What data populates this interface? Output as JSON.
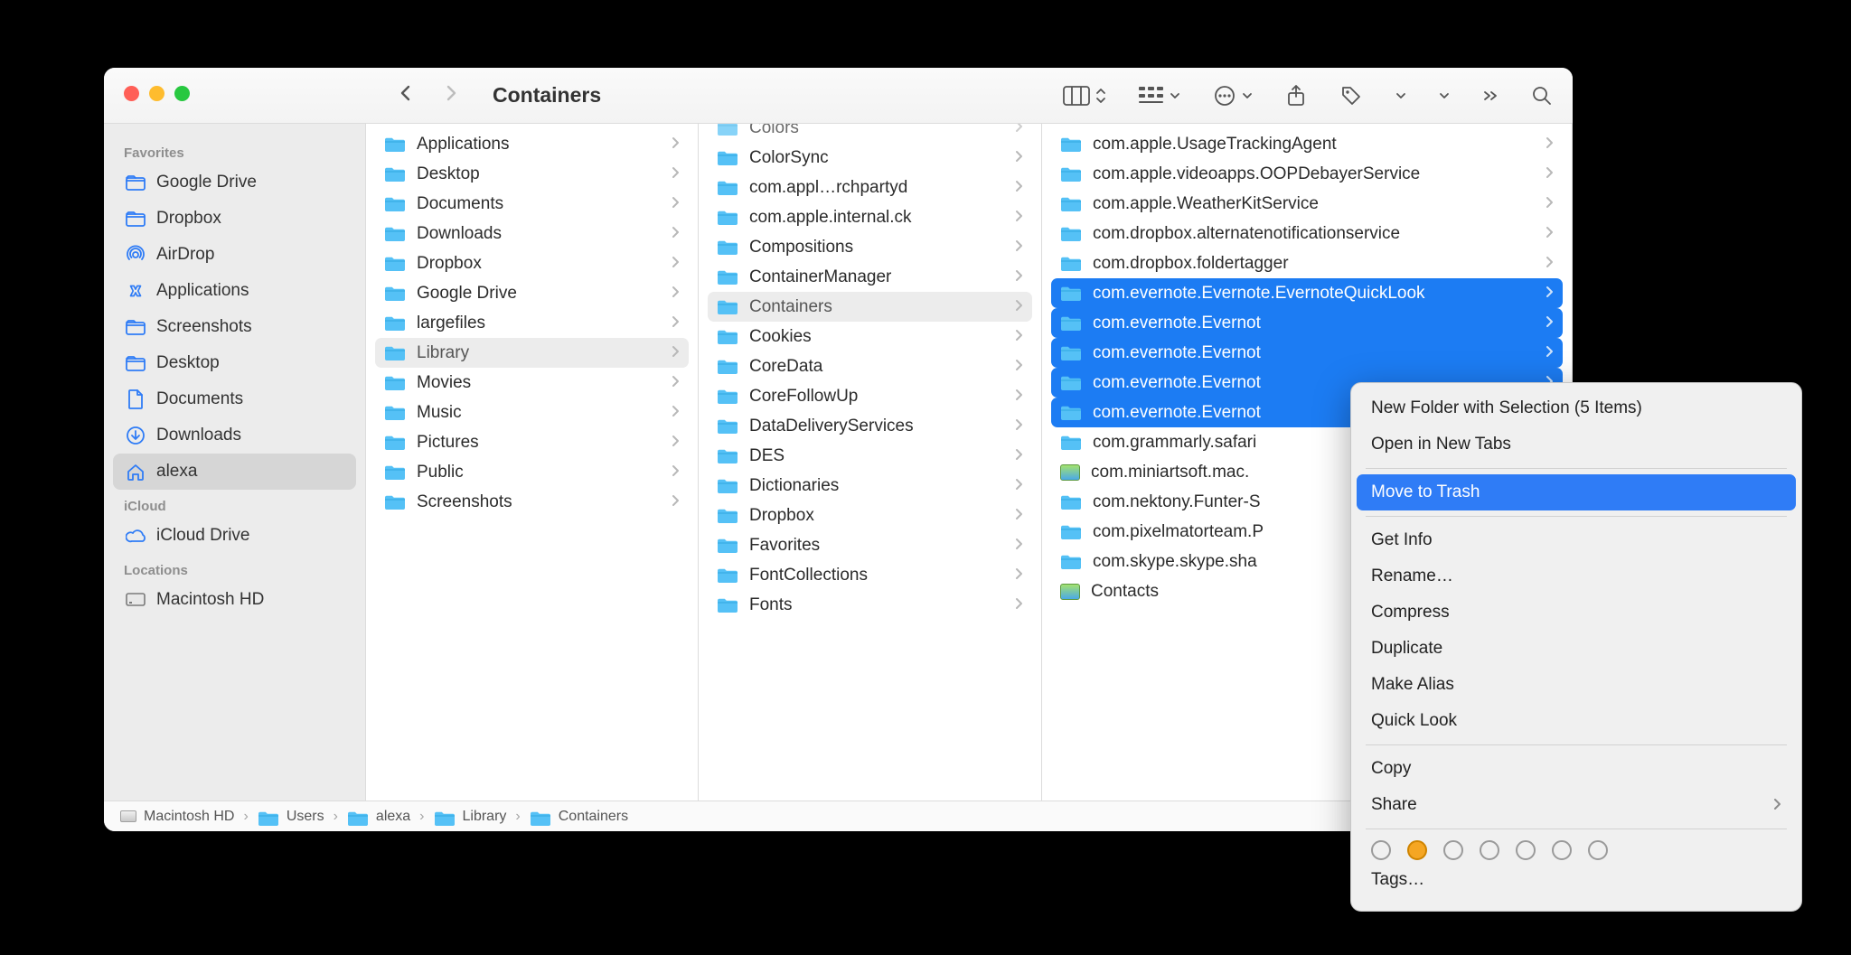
{
  "window": {
    "title": "Containers"
  },
  "sidebar": {
    "sections": [
      {
        "title": "Favorites",
        "items": [
          {
            "icon": "folder",
            "label": "Google Drive",
            "sel": false
          },
          {
            "icon": "folder",
            "label": "Dropbox",
            "sel": false
          },
          {
            "icon": "airdrop",
            "label": "AirDrop",
            "sel": false
          },
          {
            "icon": "app",
            "label": "Applications",
            "sel": false
          },
          {
            "icon": "folder",
            "label": "Screenshots",
            "sel": false
          },
          {
            "icon": "folder",
            "label": "Desktop",
            "sel": false
          },
          {
            "icon": "doc",
            "label": "Documents",
            "sel": false
          },
          {
            "icon": "down",
            "label": "Downloads",
            "sel": false
          },
          {
            "icon": "home",
            "label": "alexa",
            "sel": true
          }
        ]
      },
      {
        "title": "iCloud",
        "items": [
          {
            "icon": "cloud",
            "label": "iCloud Drive",
            "sel": false
          }
        ]
      },
      {
        "title": "Locations",
        "items": [
          {
            "icon": "disk",
            "label": "Macintosh HD",
            "sel": false
          }
        ]
      }
    ]
  },
  "columns": {
    "c1": [
      {
        "label": "Applications",
        "chev": true
      },
      {
        "label": "Desktop",
        "chev": true
      },
      {
        "label": "Documents",
        "chev": true
      },
      {
        "label": "Downloads",
        "chev": true
      },
      {
        "label": "Dropbox",
        "chev": true
      },
      {
        "label": "Google Drive",
        "chev": true
      },
      {
        "label": "largefiles",
        "chev": true
      },
      {
        "label": "Library",
        "chev": true,
        "sel": true
      },
      {
        "label": "Movies",
        "chev": true
      },
      {
        "label": "Music",
        "chev": true
      },
      {
        "label": "Pictures",
        "chev": true
      },
      {
        "label": "Public",
        "chev": true
      },
      {
        "label": "Screenshots",
        "chev": true
      }
    ],
    "c2_top": {
      "label": "Colors",
      "chev": true
    },
    "c2": [
      {
        "label": "ColorSync",
        "chev": true
      },
      {
        "label": "com.appl…rchpartyd",
        "chev": true
      },
      {
        "label": "com.apple.internal.ck",
        "chev": true
      },
      {
        "label": "Compositions",
        "chev": true
      },
      {
        "label": "ContainerManager",
        "chev": true
      },
      {
        "label": "Containers",
        "chev": true,
        "sel": true
      },
      {
        "label": "Cookies",
        "chev": true
      },
      {
        "label": "CoreData",
        "chev": true
      },
      {
        "label": "CoreFollowUp",
        "chev": true
      },
      {
        "label": "DataDeliveryServices",
        "chev": true
      },
      {
        "label": "DES",
        "chev": true
      },
      {
        "label": "Dictionaries",
        "chev": true
      },
      {
        "label": "Dropbox",
        "chev": true
      },
      {
        "label": "Favorites",
        "chev": true
      },
      {
        "label": "FontCollections",
        "chev": true
      },
      {
        "label": "Fonts",
        "chev": true
      }
    ],
    "c3": [
      {
        "label": "com.apple.UsageTrackingAgent",
        "chev": true
      },
      {
        "label": "com.apple.videoapps.OOPDebayerService",
        "chev": true
      },
      {
        "label": "com.apple.WeatherKitService",
        "chev": true
      },
      {
        "label": "com.dropbox.alternatenotificationservice",
        "chev": true
      },
      {
        "label": "com.dropbox.foldertagger",
        "chev": true
      },
      {
        "label": "com.evernote.Evernote.EvernoteQuickLook",
        "chev": true,
        "sel": true
      },
      {
        "label": "com.evernote.Evernot",
        "chev": true,
        "sel": true,
        "clip": true
      },
      {
        "label": "com.evernote.Evernot",
        "chev": true,
        "sel": true,
        "clip": true
      },
      {
        "label": "com.evernote.Evernot",
        "chev": true,
        "sel": true,
        "clip": true
      },
      {
        "label": "com.evernote.Evernot",
        "chev": true,
        "sel": true,
        "clip": true
      },
      {
        "label": "com.grammarly.safari",
        "chev": true,
        "clip": true
      },
      {
        "label": "com.miniartsoft.mac.",
        "chev": true,
        "img": true,
        "clip": true
      },
      {
        "label": "com.nektony.Funter-S",
        "chev": true,
        "clip": true
      },
      {
        "label": "com.pixelmatorteam.P",
        "chev": true,
        "clip": true
      },
      {
        "label": "com.skype.skype.sha",
        "chev": true,
        "clip": true
      },
      {
        "label": "Contacts",
        "chev": true,
        "img": true
      }
    ]
  },
  "path": [
    "Macintosh HD",
    "Users",
    "alexa",
    "Library",
    "Containers"
  ],
  "context_menu": {
    "items": [
      {
        "label": "New Folder with Selection (5 Items)"
      },
      {
        "label": "Open in New Tabs"
      },
      {
        "type": "sep"
      },
      {
        "label": "Move to Trash",
        "sel": true
      },
      {
        "type": "sep"
      },
      {
        "label": "Get Info"
      },
      {
        "label": "Rename…"
      },
      {
        "label": "Compress"
      },
      {
        "label": "Duplicate"
      },
      {
        "label": "Make Alias"
      },
      {
        "label": "Quick Look"
      },
      {
        "type": "sep"
      },
      {
        "label": "Copy"
      },
      {
        "label": "Share",
        "sub": true
      },
      {
        "type": "sep"
      },
      {
        "type": "tags"
      },
      {
        "label": "Tags…"
      }
    ],
    "tag_colors": [
      "none",
      "orange",
      "none",
      "none",
      "none",
      "none",
      "none"
    ]
  }
}
